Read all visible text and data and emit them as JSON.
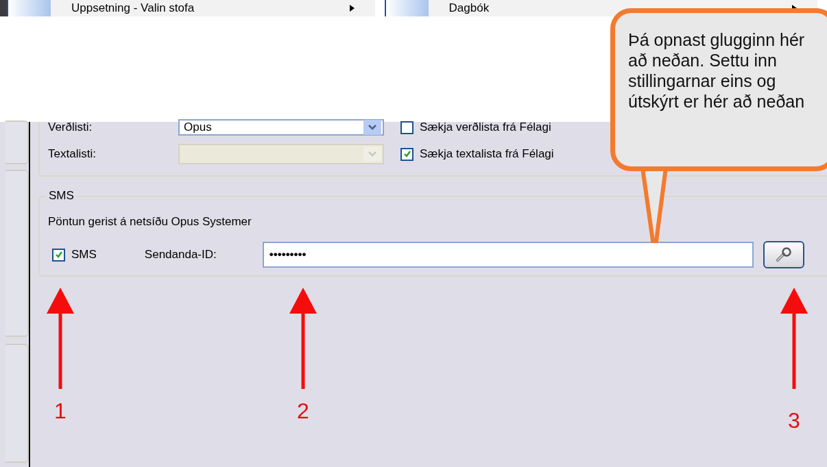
{
  "menu": [
    {
      "label": "Uppsetning - Valin stofa",
      "has_submenu": true
    },
    {
      "label": "Dagbók",
      "has_submenu": true
    }
  ],
  "list_group": {
    "rows": [
      {
        "kind": "combo",
        "label": "Verðlisti:",
        "value": "Opus",
        "disabled": false,
        "checkbox": {
          "label": "Sækja verðlista frá Félagi",
          "checked": false
        }
      },
      {
        "kind": "combo",
        "label": "Textalisti:",
        "disabled": true,
        "checkbox": {
          "label": "Sækja textalista frá Félagi",
          "checked": true
        }
      }
    ]
  },
  "sms_group": {
    "legend": "SMS",
    "info": "Pöntun gerist á netsíðu Opus Systemer",
    "checkbox": {
      "label": "SMS",
      "checked": true
    },
    "sender_label": "Sendanda-ID:",
    "sender_value": "•••••••••"
  },
  "annotations": {
    "callout": "Þá opnast glugginn hér að neðan. Settu inn stillingarnar eins og útskýrt er hér að neðan",
    "markers": [
      {
        "label": "1"
      },
      {
        "label": "2"
      },
      {
        "label": "3"
      }
    ]
  }
}
